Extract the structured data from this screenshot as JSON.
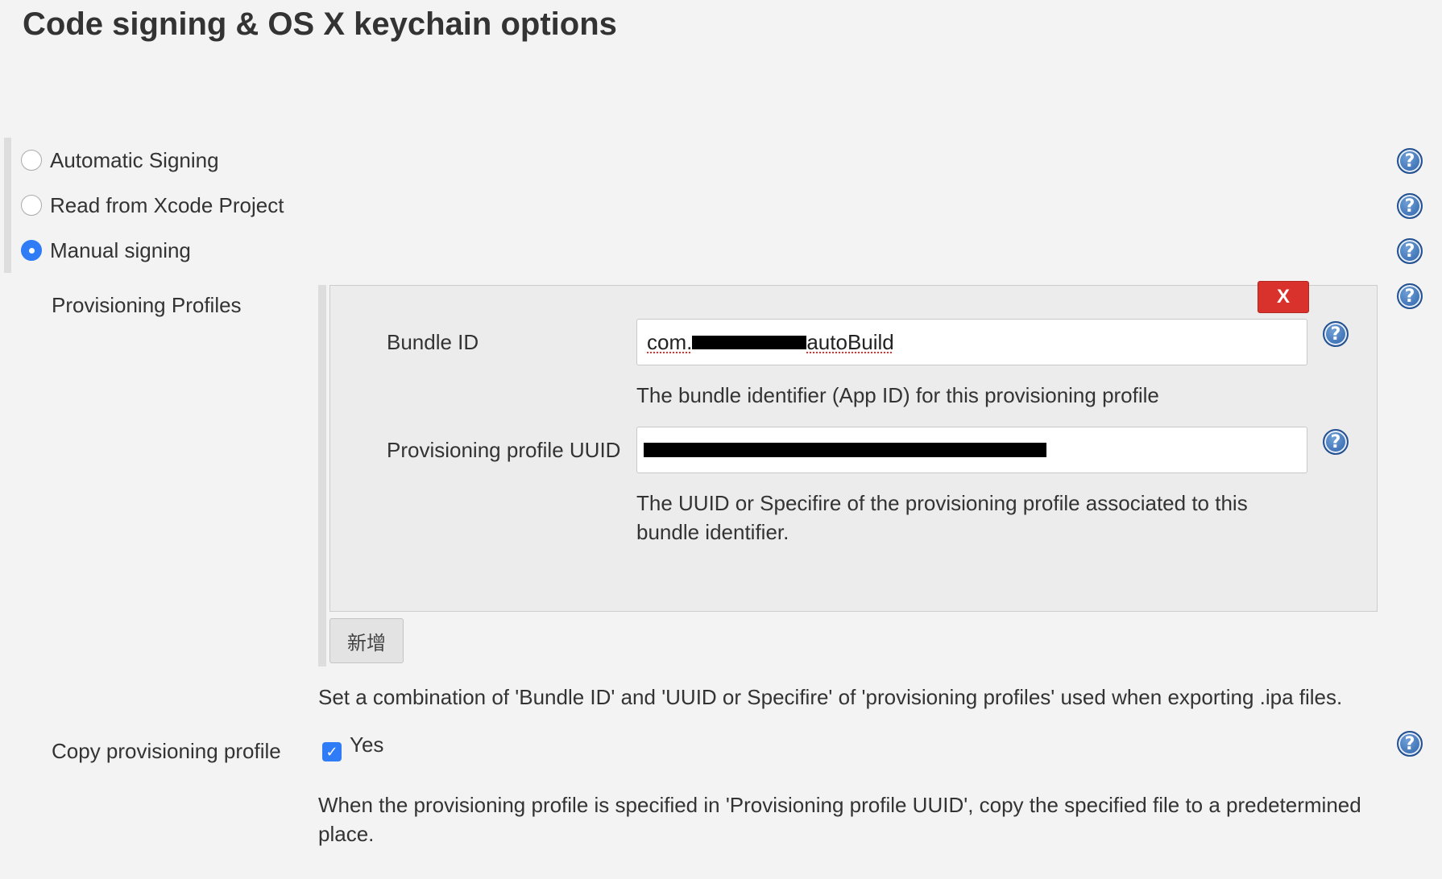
{
  "page_title": "Code signing & OS X keychain options",
  "signing_options": [
    {
      "label": "Automatic Signing",
      "selected": false
    },
    {
      "label": "Read from Xcode Project",
      "selected": false
    },
    {
      "label": "Manual signing",
      "selected": true
    }
  ],
  "help_icon_glyph": "?",
  "provisioning_profiles": {
    "label": "Provisioning Profiles",
    "delete_label": "X",
    "bundle_id": {
      "label": "Bundle ID",
      "value_prefix": "com.",
      "value_suffix": "autoBuild",
      "description": "The bundle identifier (App ID) for this provisioning profile"
    },
    "uuid": {
      "label": "Provisioning profile UUID",
      "description": "The UUID or Specifire of the provisioning profile associated to this bundle identifier."
    },
    "add_label": "新增",
    "description": "Set a combination of 'Bundle ID' and 'UUID or Specifire' of 'provisioning profiles' used when exporting .ipa files."
  },
  "copy_profile": {
    "label": "Copy provisioning profile",
    "checkbox_label": "Yes",
    "checked": true,
    "description": "When the provisioning profile is specified in 'Provisioning profile UUID', copy the specified file to a predetermined place."
  },
  "colors": {
    "accent": "#2f7cf6",
    "delete": "#d9312b",
    "background": "#f3f3f3"
  }
}
